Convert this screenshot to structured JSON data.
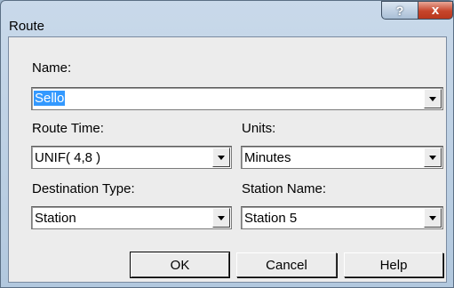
{
  "window": {
    "title": "Route",
    "help_glyph": "?",
    "close_glyph": "x",
    "help_icon": "question-mark-icon",
    "close_icon": "close-icon"
  },
  "form": {
    "name_label": "Name:",
    "name_value": "Sello",
    "route_time_label": "Route Time:",
    "route_time_value": "UNIF( 4,8 )",
    "units_label": "Units:",
    "units_value": "Minutes",
    "destination_type_label": "Destination Type:",
    "destination_type_value": "Station",
    "station_name_label": "Station Name:",
    "station_name_value": "Station 5"
  },
  "buttons": {
    "ok": "OK",
    "cancel": "Cancel",
    "help": "Help"
  }
}
